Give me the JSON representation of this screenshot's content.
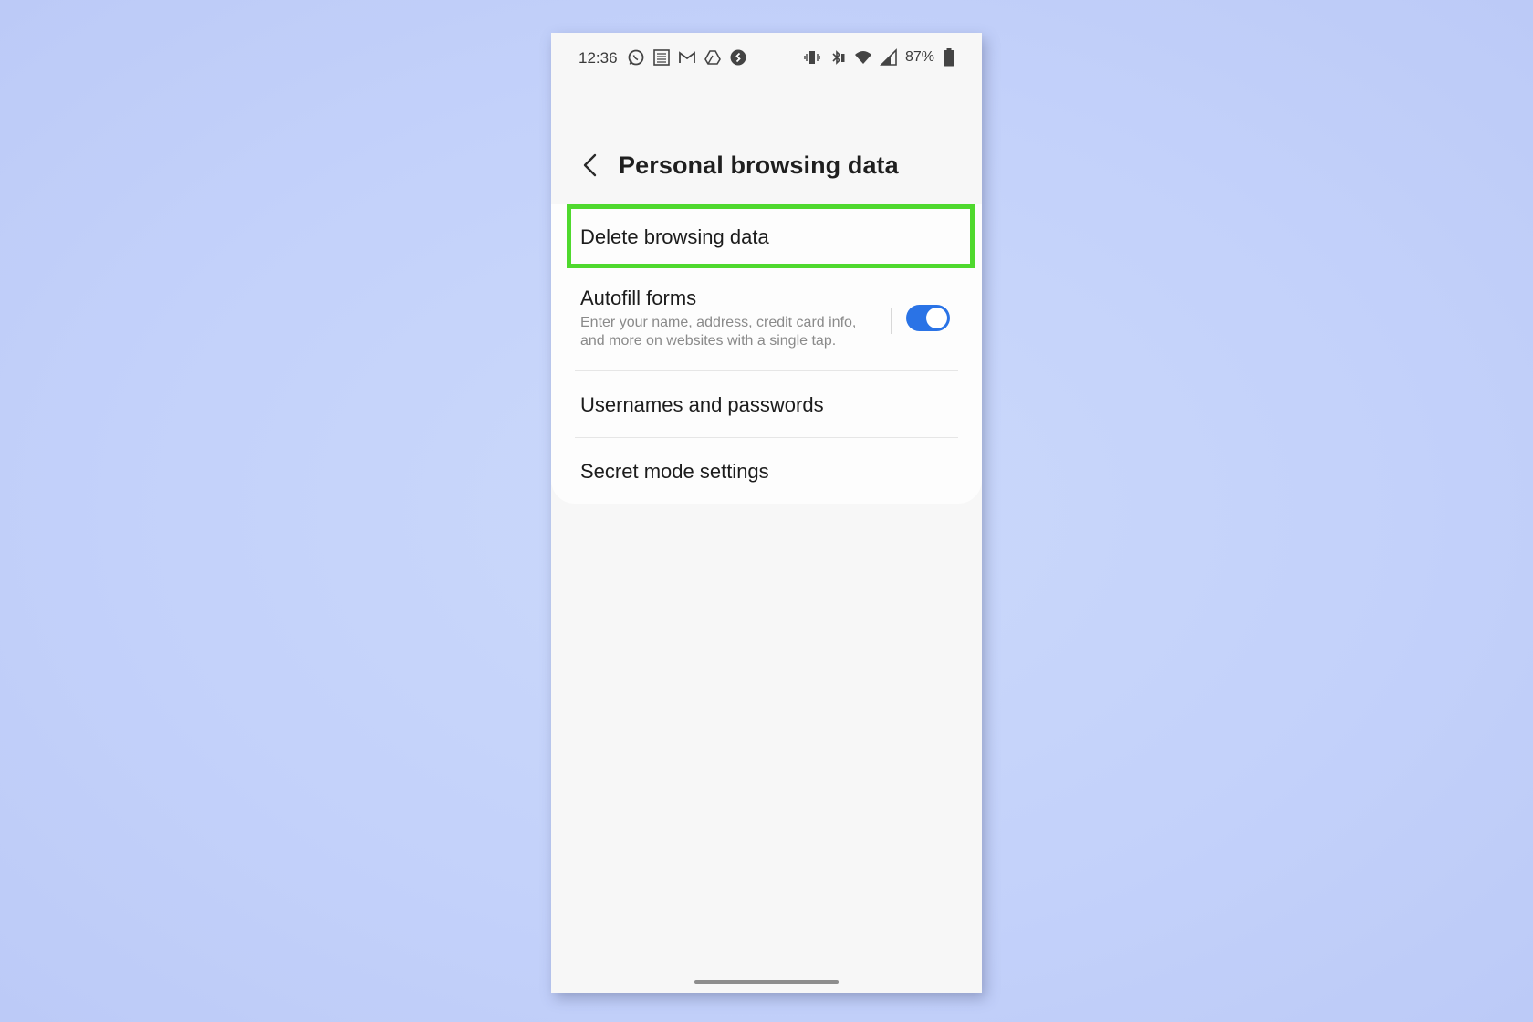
{
  "status_bar": {
    "time": "12:36",
    "left_icons": [
      "whatsapp-icon",
      "news-icon",
      "gmail-icon",
      "drive-icon",
      "shazam-icon"
    ],
    "right_icons": [
      "vibrate-icon",
      "bluetooth-icon",
      "wifi-icon",
      "signal-icon"
    ],
    "battery": "87%"
  },
  "header": {
    "title": "Personal browsing data"
  },
  "settings": {
    "items": [
      {
        "title": "Delete browsing data"
      },
      {
        "title": "Autofill forms",
        "subtitle_line1": "Enter your name, address, credit card info,",
        "subtitle_line2": "and more on websites with a single tap.",
        "toggle_on": true
      },
      {
        "title": "Usernames and passwords"
      },
      {
        "title": "Secret mode settings"
      }
    ]
  },
  "colors": {
    "highlight": "#4fd92e",
    "toggle_accent": "#2a73e6",
    "background": "#c5d3fa"
  }
}
